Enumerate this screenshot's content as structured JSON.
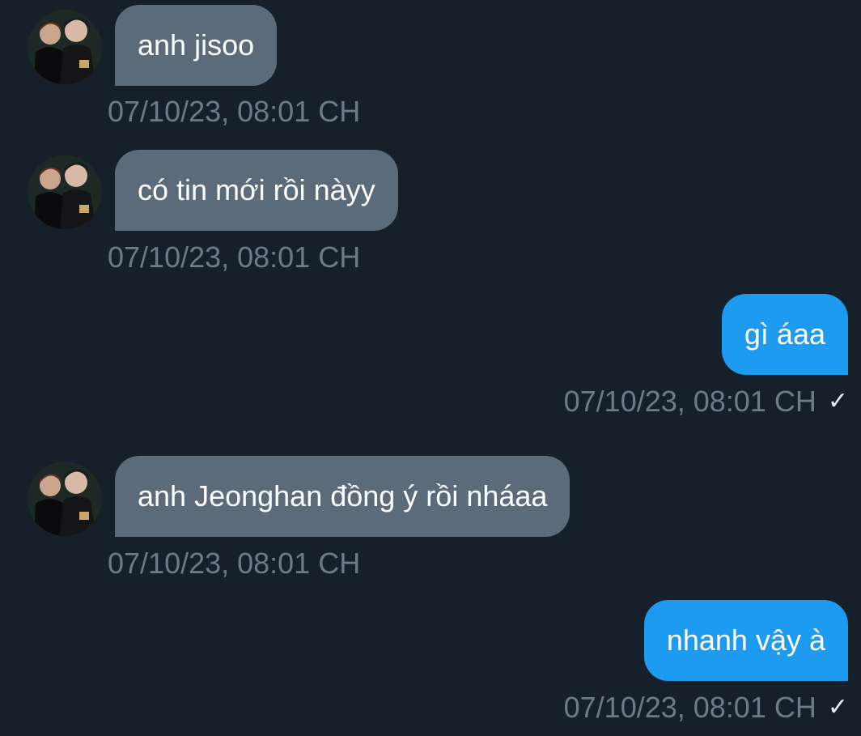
{
  "messages": [
    {
      "direction": "incoming",
      "text": "anh jisoo",
      "timestamp": "07/10/23, 08:01 CH"
    },
    {
      "direction": "incoming",
      "text": "có tin mới rồi nàyy",
      "timestamp": "07/10/23, 08:01 CH"
    },
    {
      "direction": "outgoing",
      "text": "gì áaa",
      "timestamp": "07/10/23, 08:01 CH",
      "status_icon": "checkmark-icon"
    },
    {
      "direction": "incoming",
      "text": "anh Jeonghan đồng ý rồi nháaa",
      "timestamp": "07/10/23, 08:01 CH"
    },
    {
      "direction": "outgoing",
      "text": "nhanh vậy à",
      "timestamp": "07/10/23, 08:01 CH",
      "status_icon": "checkmark-icon"
    }
  ],
  "read_receipt_glyph": "✓",
  "colors": {
    "background": "#16202a",
    "incoming_bubble": "#5b6b79",
    "outgoing_bubble": "#1d9bf0",
    "timestamp": "#6b7b89",
    "text": "#ffffff"
  }
}
